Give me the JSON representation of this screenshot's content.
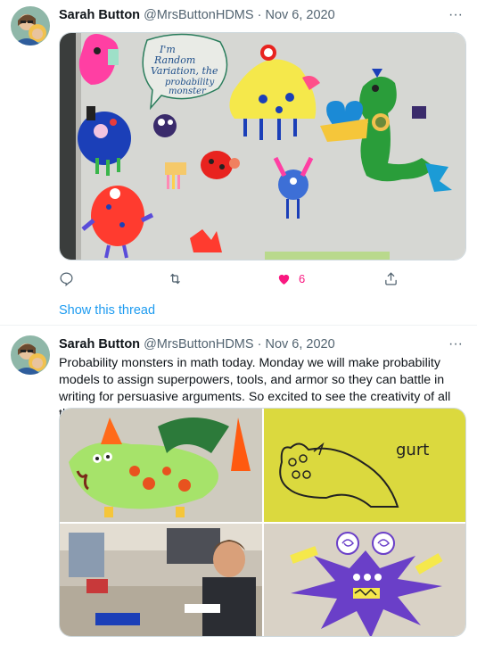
{
  "tweets": [
    {
      "author_name": "Sarah Button",
      "handle": "@MrsButtonHDMS",
      "separator": "·",
      "date": "Nov 6, 2020",
      "more_label": "···",
      "whiteboard_note": [
        "I'm",
        "Random",
        "Variation, the",
        "probability",
        "monster"
      ],
      "like_count": "6",
      "show_thread": "Show this thread"
    },
    {
      "author_name": "Sarah Button",
      "handle": "@MrsButtonHDMS",
      "separator": "·",
      "date": "Nov 6, 2020",
      "more_label": "···",
      "text": "Probability monsters in math today. Monday we will make probability models to assign superpowers, tools, and armor so they can battle in writing for persuasive arguments. So excited to see the creativity of all these kids!",
      "photo2_caption": "gurt"
    }
  ],
  "colors": {
    "link": "#1d9bf0",
    "like": "#f91880",
    "secondary_text": "#536471",
    "border": "#cfd9de"
  },
  "icons": [
    "reply-icon",
    "retweet-icon",
    "heart-icon",
    "share-icon",
    "more-icon"
  ]
}
